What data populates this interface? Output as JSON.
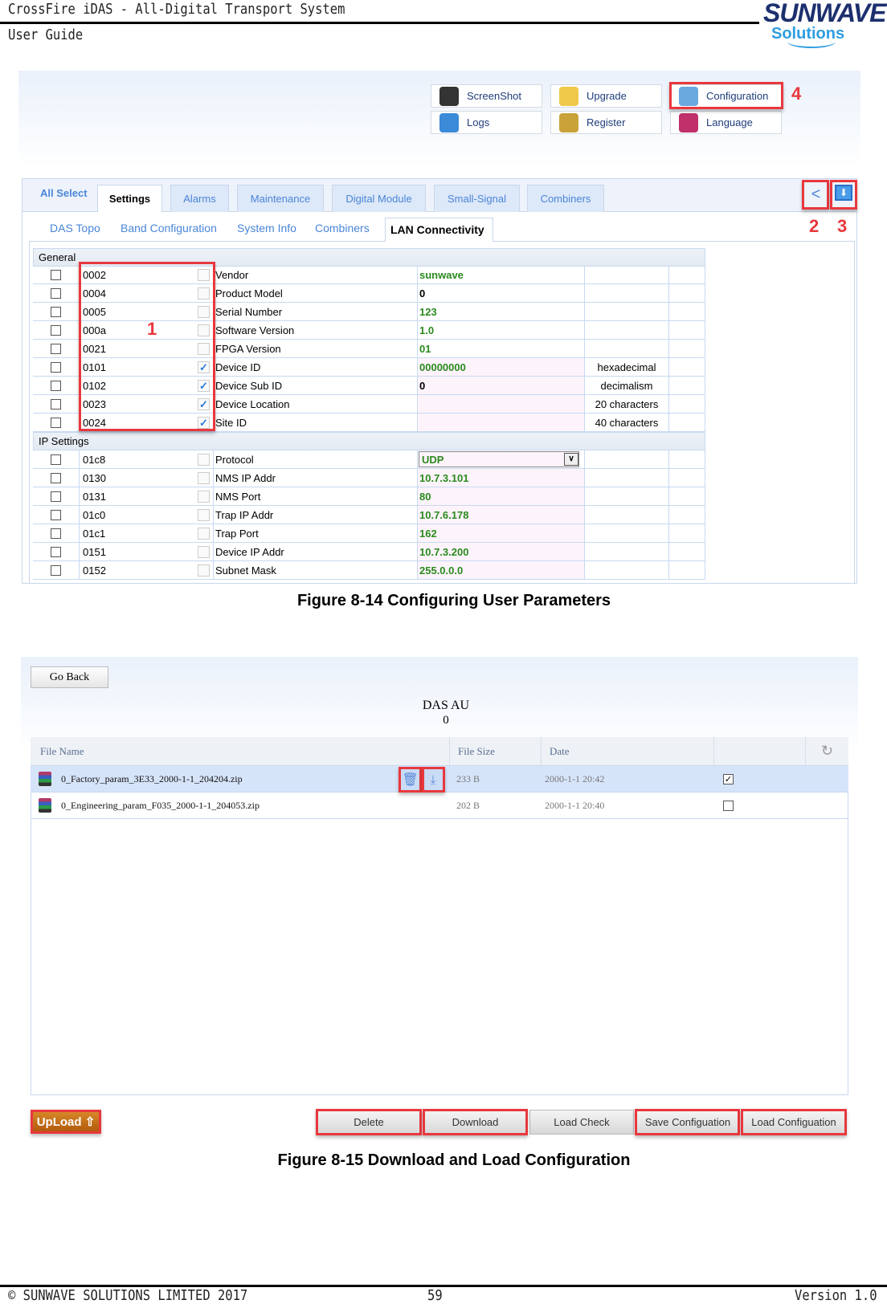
{
  "header": {
    "title": "CrossFire iDAS  - All-Digital Transport System",
    "subtitle": "User Guide",
    "logo_top": "SUNWAVE",
    "logo_bottom": "Solutions"
  },
  "fig1": {
    "toolbar": [
      {
        "label": "ScreenShot",
        "icon": "screenshot-icon"
      },
      {
        "label": "Upgrade",
        "icon": "folder-icon"
      },
      {
        "label": "Configuration",
        "icon": "brush-icon"
      },
      {
        "label": "Logs",
        "icon": "globe-icon"
      },
      {
        "label": "Register",
        "icon": "key-icon"
      },
      {
        "label": "Language",
        "icon": "language-icon"
      }
    ],
    "tabs": [
      "All Select",
      "Settings",
      "Alarms",
      "Maintenance",
      "Digital Module",
      "Small-Signal",
      "Combiners"
    ],
    "active_tab": "Settings",
    "subtabs": [
      "DAS Topo",
      "Band Configuration",
      "System Info",
      "Combiners",
      "LAN Connectivity"
    ],
    "active_subtab": "LAN Connectivity",
    "annotations": [
      "1",
      "2",
      "3",
      "4"
    ],
    "general_label": "General",
    "general_rows": [
      {
        "id": "0002",
        "checked": false,
        "name": "Vendor",
        "value": "sunwave",
        "unit": ""
      },
      {
        "id": "0004",
        "checked": false,
        "name": "Product Model",
        "value": "0",
        "unit": ""
      },
      {
        "id": "0005",
        "checked": false,
        "name": "Serial Number",
        "value": "123",
        "unit": ""
      },
      {
        "id": "000a",
        "checked": false,
        "name": "Software Version",
        "value": "1.0",
        "unit": ""
      },
      {
        "id": "0021",
        "checked": false,
        "name": "FPGA Version",
        "value": "01",
        "unit": ""
      },
      {
        "id": "0101",
        "checked": true,
        "name": "Device ID",
        "value": "00000000",
        "unit": "hexadecimal"
      },
      {
        "id": "0102",
        "checked": true,
        "name": "Device Sub ID",
        "value": "0",
        "unit": "decimalism"
      },
      {
        "id": "0023",
        "checked": true,
        "name": "Device Location",
        "value": "",
        "unit": "20 characters"
      },
      {
        "id": "0024",
        "checked": true,
        "name": "Site ID",
        "value": "",
        "unit": "40 characters"
      }
    ],
    "ip_label": "IP Settings",
    "ip_rows": [
      {
        "id": "01c8",
        "checked": false,
        "name": "Protocol",
        "value": "UDP",
        "unit": "",
        "select": true
      },
      {
        "id": "0130",
        "checked": false,
        "name": "NMS IP Addr",
        "value": "10.7.3.101",
        "unit": ""
      },
      {
        "id": "0131",
        "checked": false,
        "name": "NMS Port",
        "value": "80",
        "unit": ""
      },
      {
        "id": "01c0",
        "checked": false,
        "name": "Trap IP Addr",
        "value": "10.7.6.178",
        "unit": ""
      },
      {
        "id": "01c1",
        "checked": false,
        "name": "Trap Port",
        "value": "162",
        "unit": ""
      },
      {
        "id": "0151",
        "checked": false,
        "name": "Device IP Addr",
        "value": "10.7.3.200",
        "unit": ""
      },
      {
        "id": "0152",
        "checked": false,
        "name": "Subnet Mask",
        "value": "255.0.0.0",
        "unit": ""
      }
    ],
    "caption": "Figure 8-14 Configuring User Parameters"
  },
  "fig2": {
    "go_back": "Go Back",
    "title": "DAS AU",
    "subtitle": "0",
    "columns": [
      "File Name",
      "File Size",
      "Date"
    ],
    "files": [
      {
        "name": "0_Factory_param_3E33_2000-1-1_204204.zip",
        "size": "233 B",
        "date": "2000-1-1 20:42",
        "checked": true
      },
      {
        "name": "0_Engineering_param_F035_2000-1-1_204053.zip",
        "size": "202 B",
        "date": "2000-1-1 20:40",
        "checked": false
      }
    ],
    "upload": "UpLoad",
    "buttons": [
      "Delete",
      "Download",
      "Load Check",
      "Save Configuation",
      "Load Configuation"
    ],
    "caption": "Figure 8-15 Download and Load Configuration"
  },
  "footer": {
    "copyright": "© SUNWAVE SOLUTIONS LIMITED 2017",
    "page": "59",
    "version": "Version 1.0"
  },
  "colors": {
    "annotation_red": "#e8383d",
    "value_green": "#2a8a1e",
    "tab_blue": "#4a86d8"
  }
}
